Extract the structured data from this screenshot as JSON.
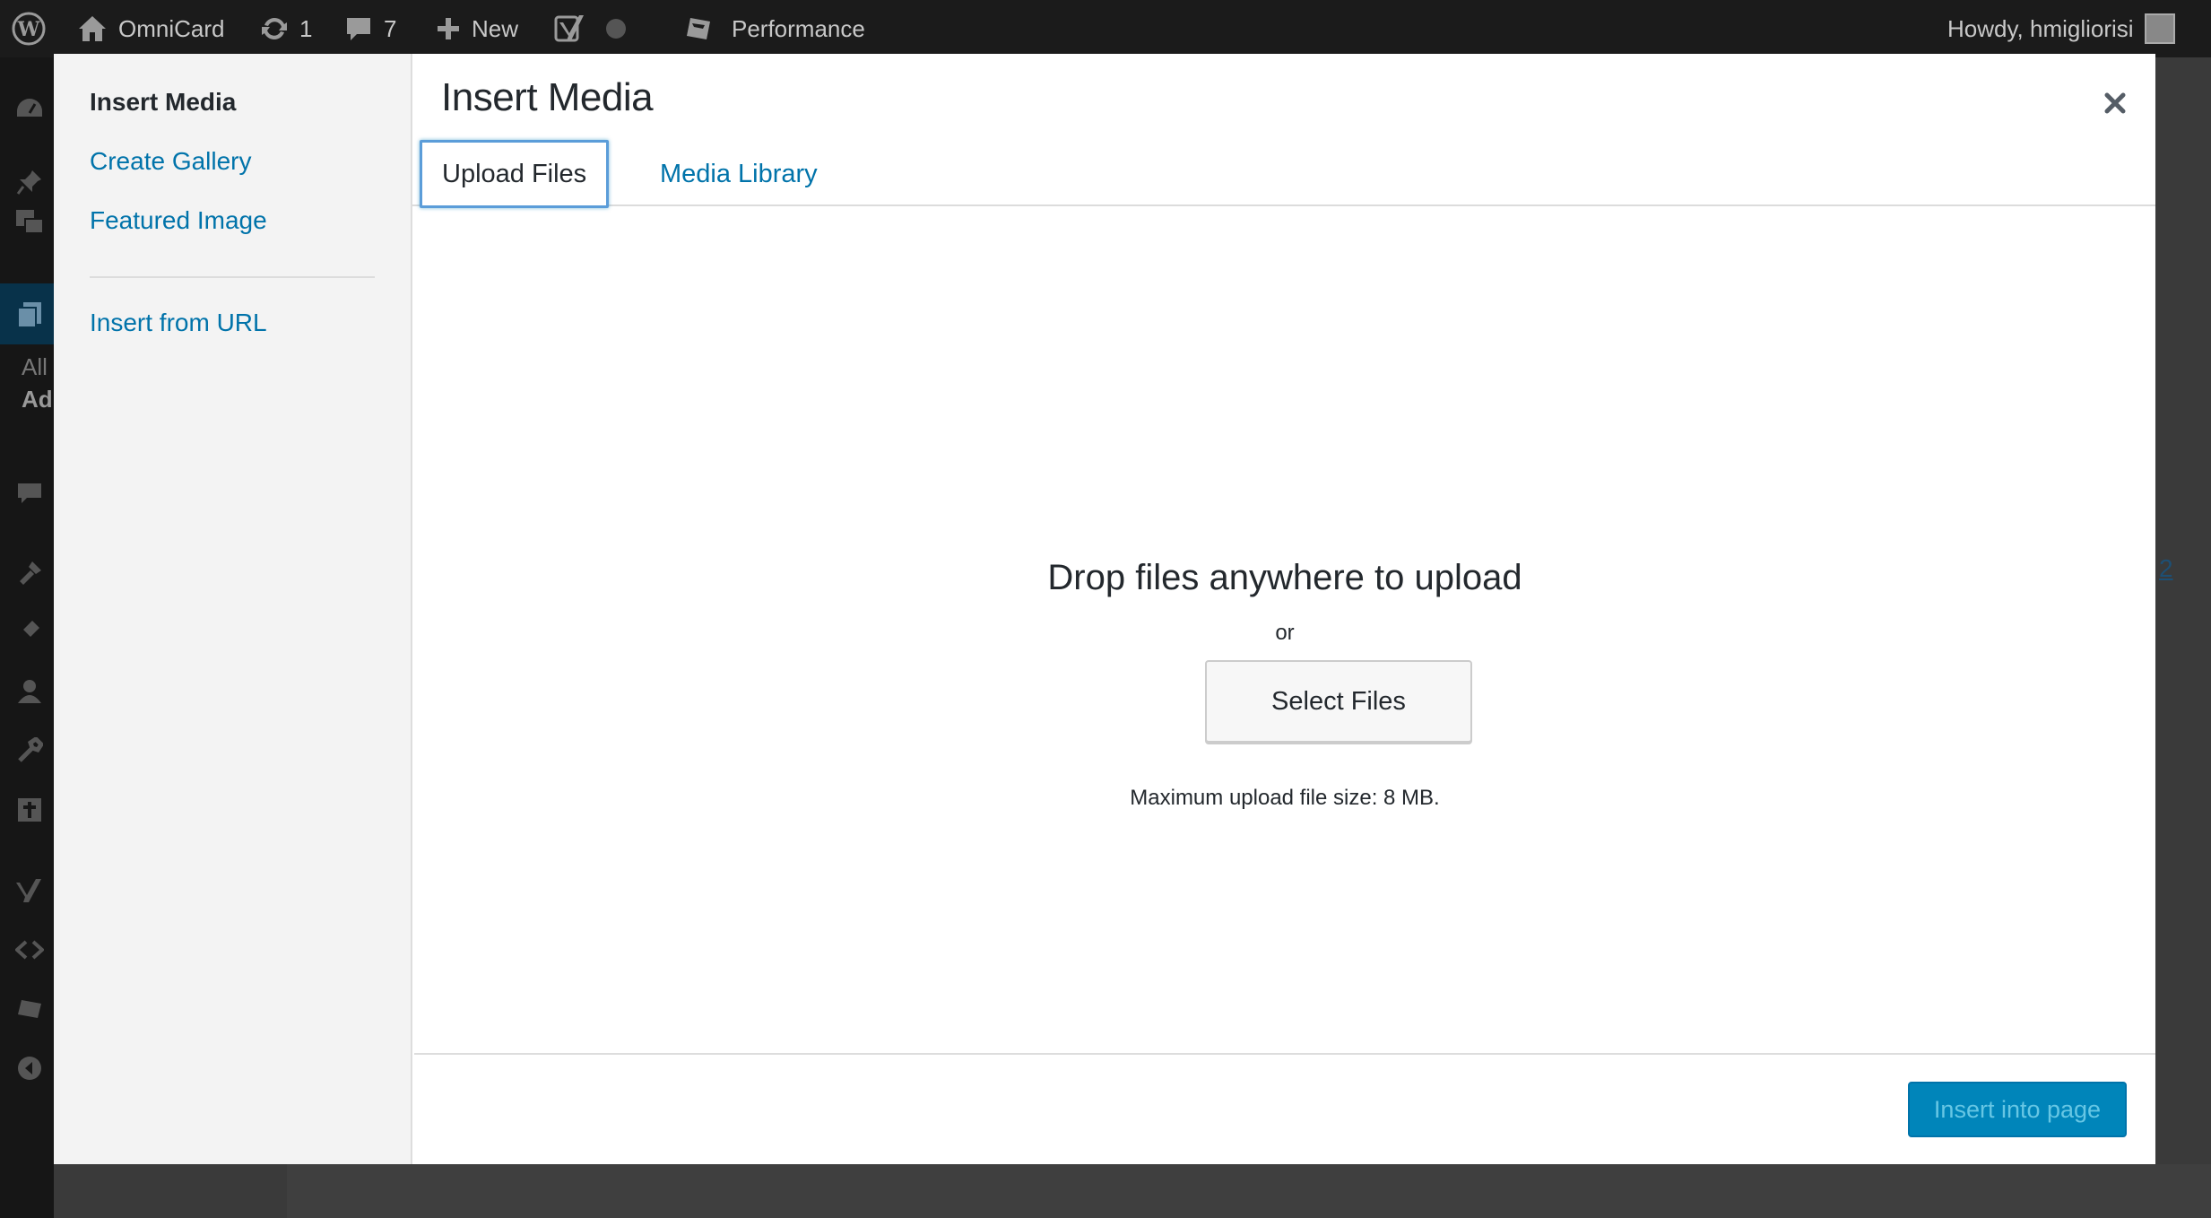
{
  "admin_bar": {
    "site_name": "OmniCard",
    "updates_count": "1",
    "comments_count": "7",
    "new_label": "New",
    "performance_label": "Performance",
    "howdy": "Howdy, hmigliorisi"
  },
  "admin_menu": {
    "all_label": "All",
    "add_label": "Ad"
  },
  "page_behind": {
    "link_fragment": "2"
  },
  "modal": {
    "title": "Insert Media",
    "sidebar": {
      "items": [
        {
          "label": "Insert Media"
        },
        {
          "label": "Create Gallery"
        },
        {
          "label": "Featured Image"
        },
        {
          "label": "Insert from URL"
        }
      ]
    },
    "tabs": [
      {
        "label": "Upload Files"
      },
      {
        "label": "Media Library"
      }
    ],
    "upload": {
      "drop_title": "Drop files anywhere to upload",
      "or_text": "or",
      "select_button": "Select Files",
      "max_size": "Maximum upload file size: 8 MB."
    },
    "insert_button": "Insert into page"
  },
  "colors": {
    "link": "#0073aa",
    "primary_button": "#0085ba",
    "focus_ring": "#5b9dd9",
    "admin_bar": "#1b1b1b"
  }
}
